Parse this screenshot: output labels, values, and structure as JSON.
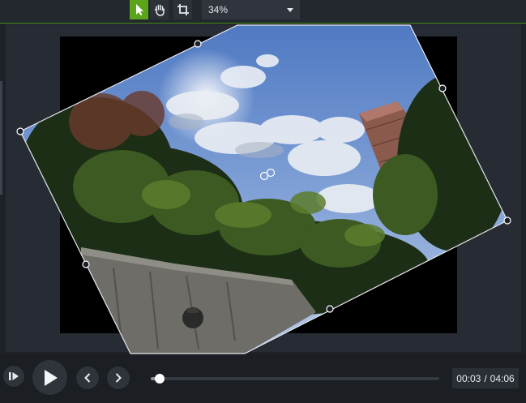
{
  "toolbar": {
    "tools": [
      {
        "name": "select",
        "icon": "cursor-arrow-icon",
        "active": true
      },
      {
        "name": "pan",
        "icon": "hand-icon",
        "active": false
      },
      {
        "name": "crop",
        "icon": "crop-icon",
        "active": false
      }
    ],
    "zoom_value": "34%",
    "accent_color": "#5aa51a"
  },
  "playback": {
    "current_time": "00:03",
    "separator": "/",
    "duration": "04:06",
    "progress_fraction": 0.02,
    "buttons": [
      {
        "name": "step-play",
        "icon": "step-play-icon"
      },
      {
        "name": "play",
        "icon": "play-icon"
      },
      {
        "name": "previous",
        "icon": "chevron-left-icon"
      },
      {
        "name": "next",
        "icon": "chevron-right-icon"
      }
    ]
  }
}
